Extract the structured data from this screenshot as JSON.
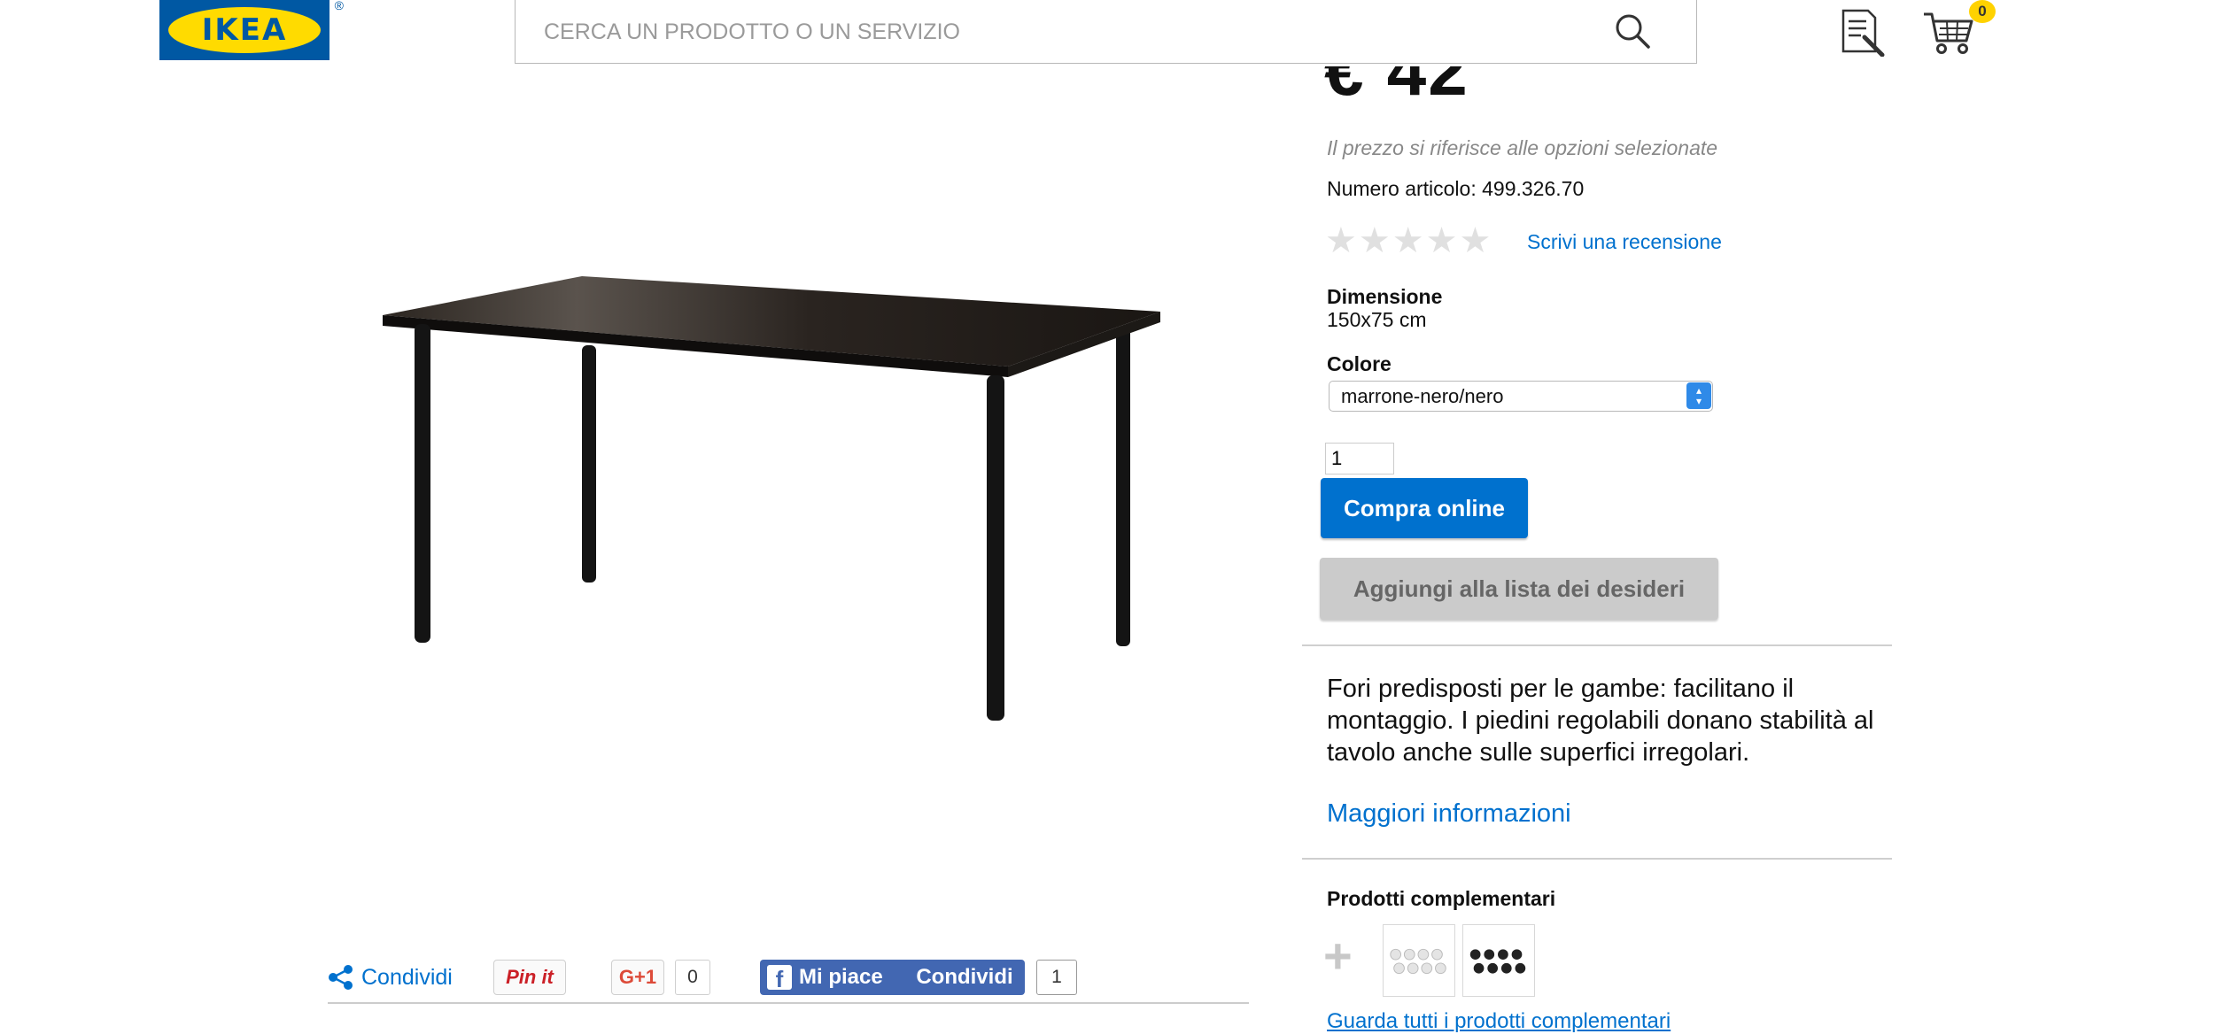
{
  "header": {
    "logo_text": "IKEA",
    "logo_reg": "®",
    "search_placeholder": "CERCA UN PRODOTTO O UN SERVIZIO",
    "cart_count": "0"
  },
  "product": {
    "price": "€ 42",
    "price_note": "Il prezzo si riferisce alle opzioni selezionate",
    "article_number": "Numero articolo: 499.326.70",
    "rating_stars": 0,
    "review_link": "Scrivi una recensione",
    "dimension_label": "Dimensione",
    "dimension_value": "150x75 cm",
    "color_label": "Colore",
    "color_value": "marrone-nero/nero",
    "quantity": "1",
    "buy_label": "Compra online",
    "wishlist_label": "Aggiungi alla lista dei desideri",
    "description": "Fori predisposti per le gambe: facilitano il montaggio. I piedini regolabili donano stabilità al tavolo anche sulle superfici irregolari.",
    "more_info": "Maggiori informazioni",
    "complementary_title": "Prodotti complementari",
    "complementary_link": "Guarda tutti i prodotti complementari"
  },
  "share": {
    "share_label": "Condividi",
    "pin_label": "Pin it",
    "gplus_label": "G+1",
    "gplus_count": "0",
    "fb_like_label": "Mi piace",
    "fb_share_label": "Condividi",
    "fb_count": "1"
  },
  "colors": {
    "accent_blue": "#0071ce",
    "facebook_blue": "#4267b2",
    "ikea_yellow": "#ffdb00",
    "ikea_blue": "#0058a3"
  }
}
